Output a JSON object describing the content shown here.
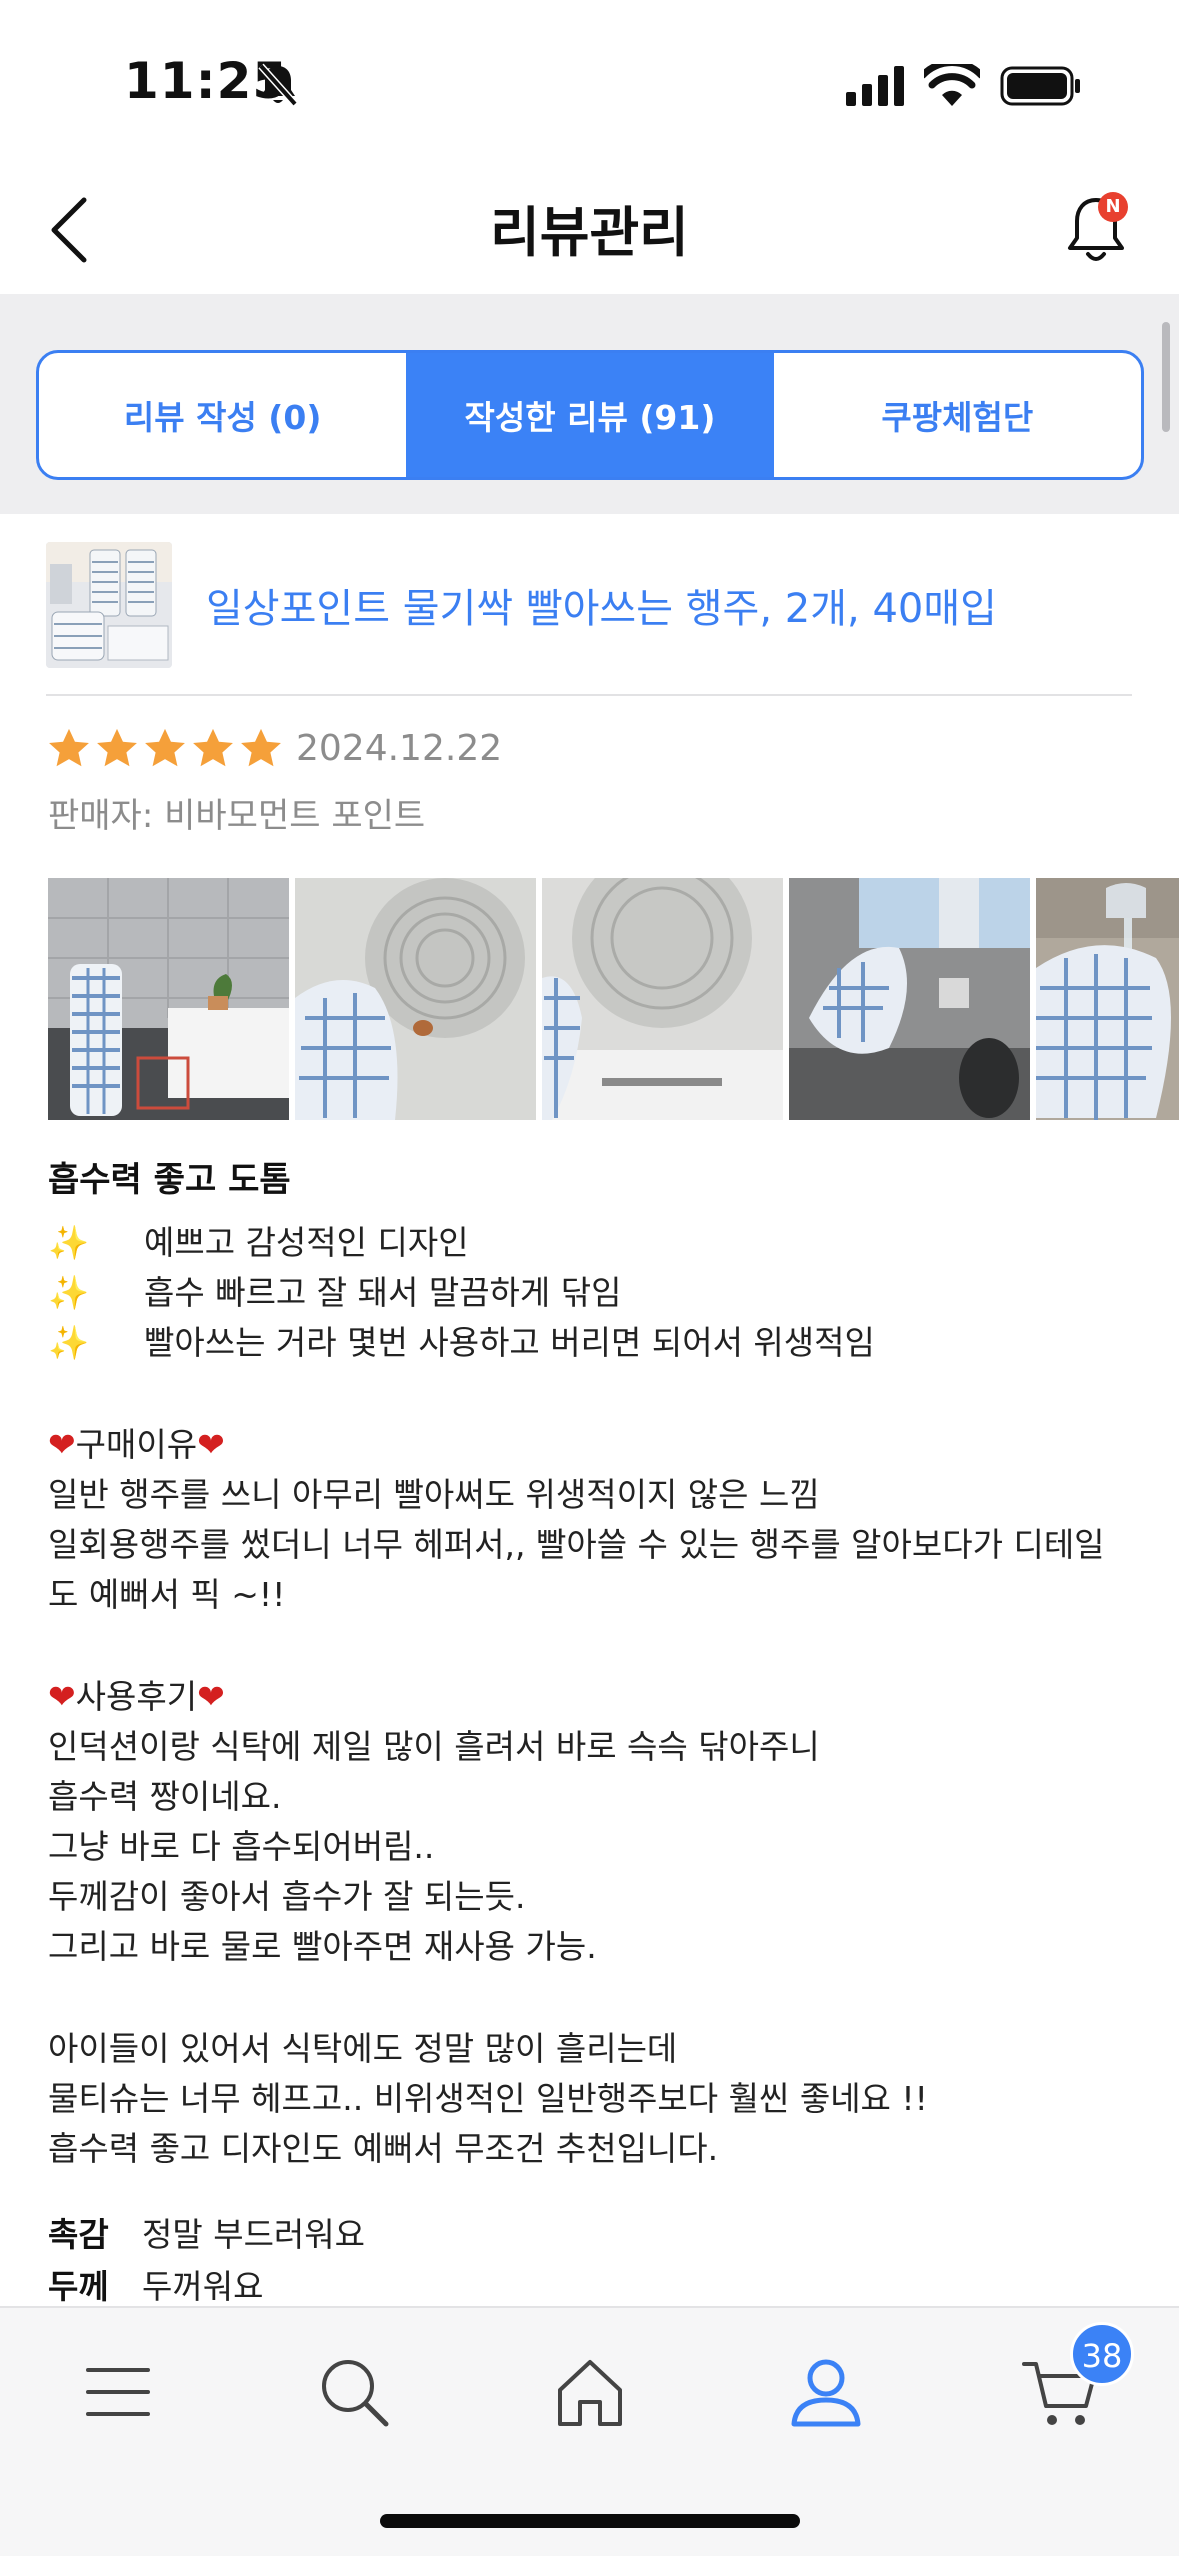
{
  "status_bar": {
    "time": "11:25"
  },
  "header": {
    "title": "리뷰관리",
    "notification_badge": "N"
  },
  "tabs": [
    {
      "label": "리뷰 작성 (0)",
      "active": false
    },
    {
      "label": "작성한 리뷰 (91)",
      "active": true
    },
    {
      "label": "쿠팡체험단",
      "active": false
    }
  ],
  "product": {
    "name": "일상포인트 물기싹 빨아쓰는 행주, 2개, 40매입"
  },
  "review": {
    "rating": 5,
    "max_rating": 5,
    "date": "2024.12.22",
    "seller_label": "판매자:",
    "seller_name": "비바모먼트 포인트",
    "photo_count_visible": 5,
    "title": "흡수력 좋고 도톰",
    "sparkle_lines": [
      "예쁘고 감성적인 디자인",
      "흡수 빠르고 잘 돼서 말끔하게 닦임",
      "빨아쓰는 거라 몇번 사용하고 버리면 되어서 위생적임"
    ],
    "reason_heading": "구매이유",
    "reason_lines": [
      "일반 행주를 쓰니 아무리 빨아써도 위생적이지 않은 느낌",
      "일회용행주를 썼더니 너무 헤퍼서,, 빨아쓸 수 있는 행주를 알아보다가 디테일",
      "도 예뻐서 픽 ~!!"
    ],
    "usage_heading": "사용후기",
    "usage_lines": [
      "인덕션이랑 식탁에 제일 많이 흘려서 바로 슥슥 닦아주니",
      "흡수력 짱이네요.",
      "그냥 바로 다 흡수되어버림..",
      "두께감이 좋아서 흡수가 잘 되는듯.",
      "그리고 바로 물로 빨아주면 재사용 가능."
    ],
    "closing_lines": [
      "아이들이 있어서 식탁에도 정말 많이 흘리는데",
      "물티슈는 너무 헤프고.. 비위생적인 일반행주보다 훨씬 좋네요 !!",
      "흡수력 좋고 디자인도 예뻐서 무조건 추천입니다."
    ],
    "attributes": [
      {
        "key": "촉감",
        "value": "정말 부드러워요"
      },
      {
        "key": "두께",
        "value": "두꺼워요"
      }
    ]
  },
  "bottom_nav": {
    "items": [
      "menu-icon",
      "search-icon",
      "home-icon",
      "profile-icon",
      "cart-icon"
    ],
    "active": "profile-icon",
    "cart_count": "38"
  },
  "colors": {
    "accent": "#3b82f6",
    "star": "#f5a03a",
    "link": "#3b7ff2"
  }
}
